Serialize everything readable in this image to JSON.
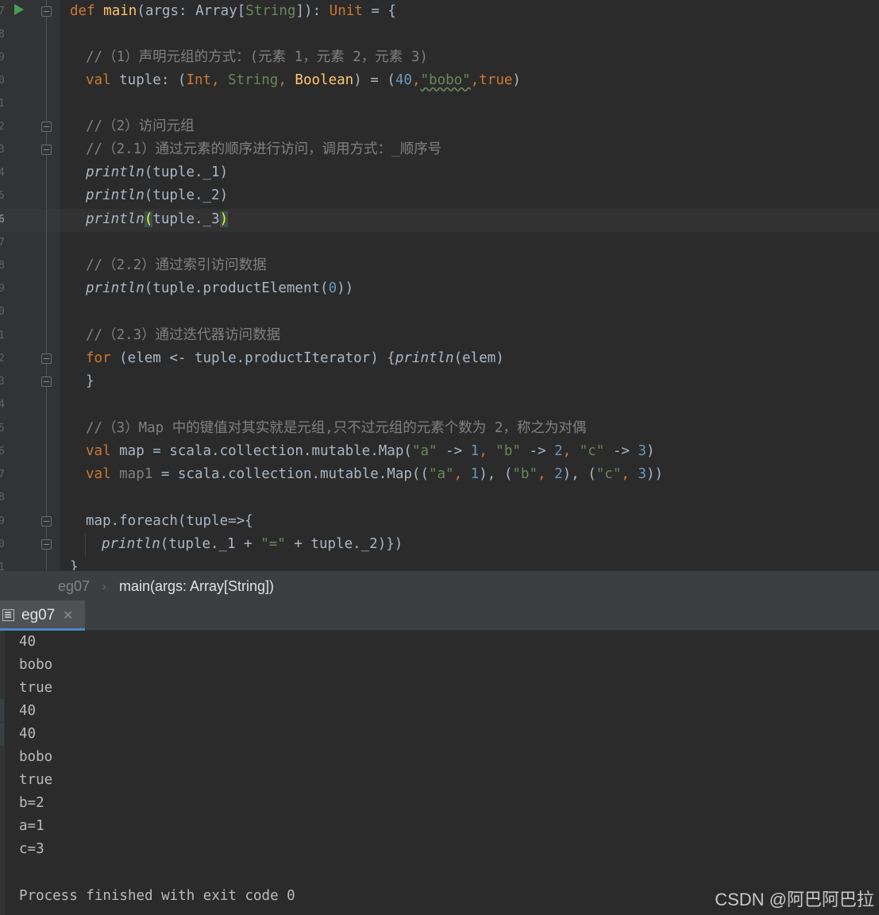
{
  "editor": {
    "line_numbers": [
      "7",
      "8",
      "9",
      "0",
      "1",
      "2",
      "3",
      "4",
      "5",
      "6",
      "7",
      "8",
      "9",
      "0",
      "1",
      "2",
      "3",
      "4",
      "5",
      "6",
      "7",
      "8",
      "9",
      "0",
      "1"
    ],
    "code": {
      "l1": {
        "def": "def",
        "name": "main",
        "a": "(args: Array[",
        "t": "String",
        "b": "]): ",
        "unit": "Unit",
        "c": " = {"
      },
      "l3": "//（1）声明元组的方式：(元素 1，元素 2，元素 3)",
      "l4": {
        "val": "val",
        "a": " tuple: (",
        "t1": "Int",
        "s1": ", ",
        "t2": "String",
        "s2": ", ",
        "t3": "Boolean",
        "b": ") = (",
        "n": "40",
        "c": ",",
        "str": "\"bobo\"",
        "d": ",",
        "tr": "true",
        "e": ")"
      },
      "l6": "//（2）访问元组",
      "l7": "//（2.1）通过元素的顺序进行访问，调用方式：_顺序号",
      "l8": {
        "p": "println",
        "a": "(tuple._1)"
      },
      "l9": {
        "p": "println",
        "a": "(tuple._2)"
      },
      "l10": {
        "p": "println",
        "o": "(",
        "a": "tuple._3",
        "c": ")"
      },
      "l12": "//（2.2）通过索引访问数据",
      "l13": {
        "p": "println",
        "a": "(tuple.productElement(",
        "n": "0",
        "b": "))"
      },
      "l15": "//（2.3）通过迭代器访问数据",
      "l16": {
        "for": "for",
        "a": " (elem <- tuple.productIterator) {",
        "p": "println",
        "b": "(elem)"
      },
      "l17": "}",
      "l19": {
        "c": "//（3）Map 中的键值对其实就是元组,只不过元组的元素个数为 2，称之为对偶"
      },
      "l20": {
        "val": "val",
        "a": " map = scala.collection.mutable.Map(",
        "s1": "\"a\"",
        "b": " -> ",
        "n1": "1",
        "c1": ", ",
        "s2": "\"b\"",
        "d": " -> ",
        "n2": "2",
        "c2": ", ",
        "s3": "\"c\"",
        "e": " -> ",
        "n3": "3",
        "f": ")"
      },
      "l21": {
        "val": "val",
        "name": " map1",
        "a": " = scala.collection.mutable.Map((",
        "s1": "\"a\"",
        "c1": ", ",
        "n1": "1",
        "b": "), (",
        "s2": "\"b\"",
        "c2": ", ",
        "n2": "2",
        "d": "), (",
        "s3": "\"c\"",
        "c3": ", ",
        "n3": "3",
        "e": "))"
      },
      "l23": "map.foreach(tuple=>{",
      "l24": {
        "p": "println",
        "a": "(tuple._1 + ",
        "s": "\"=\"",
        "b": " + tuple._2)})"
      },
      "l25": "}"
    }
  },
  "breadcrumb": {
    "file": "eg07",
    "separator": "›",
    "method": "main(args: Array[String])"
  },
  "run_tab": {
    "label": "eg07",
    "close": "✕"
  },
  "console": {
    "lines": [
      "40",
      "bobo",
      "true",
      "40",
      "40",
      "bobo",
      "true",
      "b=2",
      "a=1",
      "c=3"
    ],
    "finished": "Process finished with exit code 0"
  },
  "watermark": "CSDN @阿巴阿巴拉",
  "colors": {
    "background": "#2b2b2b",
    "keyword": "#cc7832",
    "string": "#6a8759",
    "number": "#6897bb",
    "comment": "#808080",
    "function": "#ffc66d"
  }
}
